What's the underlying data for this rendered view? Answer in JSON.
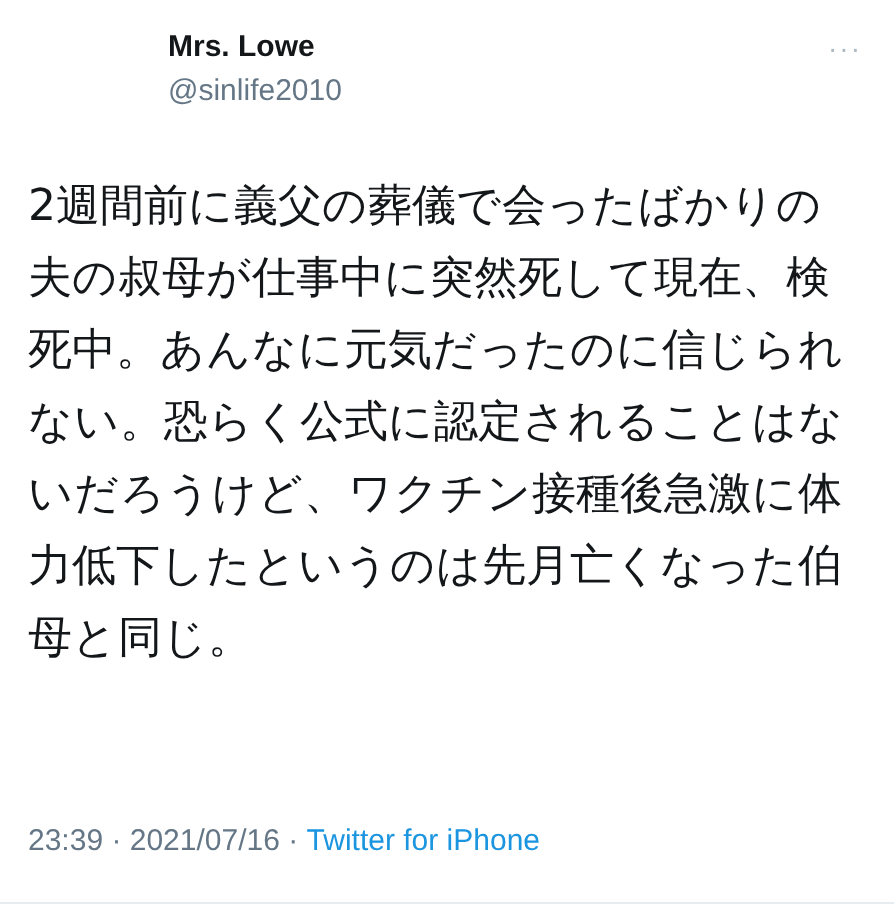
{
  "author": {
    "name": "Mrs. Lowe",
    "handle": "@sinlife2010"
  },
  "more_menu": "···",
  "body": "2週間前に義父の葬儀で会ったばかりの夫の叔母が仕事中に突然死して現在、検死中。あんなに元気だったのに信じられない。恐らく公式に認定されることはないだろうけど、ワクチン接種後急激に体力低下したというのは先月亡くなった伯母と同じ。",
  "meta": {
    "timestamp": "23:39 · 2021/07/16 · ",
    "source": "Twitter for iPhone"
  }
}
